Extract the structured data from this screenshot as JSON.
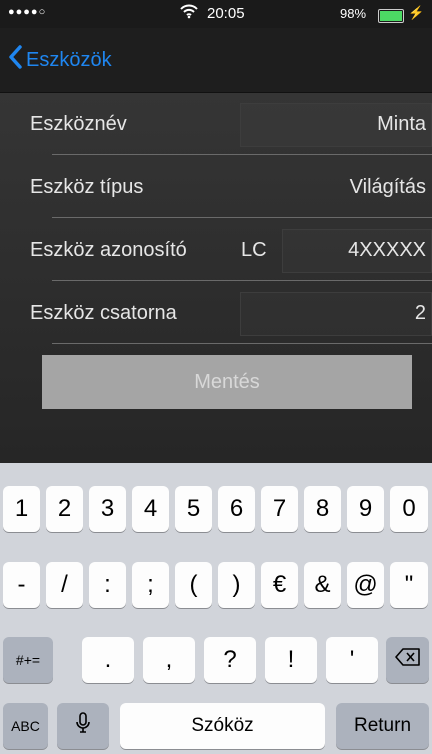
{
  "status_bar": {
    "signal": "●●●●○",
    "time": "20:05",
    "battery_percent": "98%",
    "battery_color": "#4cd964"
  },
  "navbar": {
    "back_label": "Eszközök",
    "accent_color": "#1f86f0"
  },
  "form": {
    "rows": [
      {
        "label": "Eszköznév",
        "value": "Minta"
      },
      {
        "label": "Eszköz típus",
        "value": "Világítás"
      },
      {
        "label": "Eszköz azonosító",
        "prefix": "LC",
        "value": "4XXXXX"
      },
      {
        "label": "Eszköz csatorna",
        "value": "2"
      }
    ],
    "save_label": "Mentés"
  },
  "keyboard": {
    "row1": [
      "1",
      "2",
      "3",
      "4",
      "5",
      "6",
      "7",
      "8",
      "9",
      "0"
    ],
    "row2": [
      "-",
      "/",
      ":",
      ";",
      "(",
      ")",
      "€",
      "&",
      "@",
      "\""
    ],
    "row3_toggle": "#+=",
    "row3": [
      ".",
      ",",
      "?",
      "!",
      "'"
    ],
    "delete_icon": "backspace-icon",
    "abc_label": "ABC",
    "mic_icon": "microphone-icon",
    "space_label": "Szóköz",
    "return_label": "Return"
  }
}
